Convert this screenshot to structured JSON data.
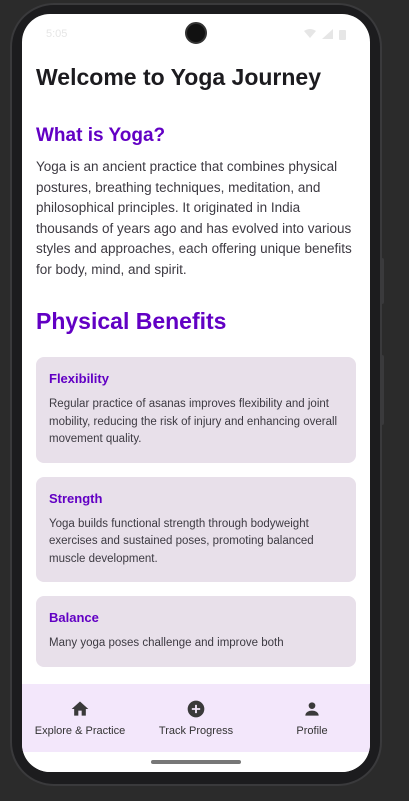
{
  "status_bar": {
    "time": "5:05",
    "icons": [
      "wifi-icon",
      "signal-icon",
      "battery-icon"
    ]
  },
  "page": {
    "title": "Welcome to Yoga Journey"
  },
  "about": {
    "heading": "What is Yoga?",
    "text": "Yoga is an ancient practice that combines physical postures, breathing techniques, meditation, and philosophical principles. It originated in India thousands of years ago and has evolved into various styles and approaches, each offering unique benefits for body, mind, and spirit."
  },
  "benefits": {
    "heading": "Physical Benefits",
    "cards": [
      {
        "title": "Flexibility",
        "text": "Regular practice of asanas improves flexibility and joint mobility, reducing the risk of injury and enhancing overall movement quality."
      },
      {
        "title": "Strength",
        "text": "Yoga builds functional strength through bodyweight exercises and sustained poses, promoting balanced muscle development."
      },
      {
        "title": "Balance",
        "text": "Many yoga poses challenge and improve both"
      }
    ]
  },
  "bottom_nav": {
    "items": [
      {
        "label": "Explore & Practice",
        "icon": "home-icon"
      },
      {
        "label": "Track Progress",
        "icon": "add-circle-icon"
      },
      {
        "label": "Profile",
        "icon": "person-icon"
      }
    ]
  },
  "colors": {
    "accent": "#6200c4",
    "card_bg": "#e8e0ea",
    "nav_bg": "#f3e7fb"
  }
}
